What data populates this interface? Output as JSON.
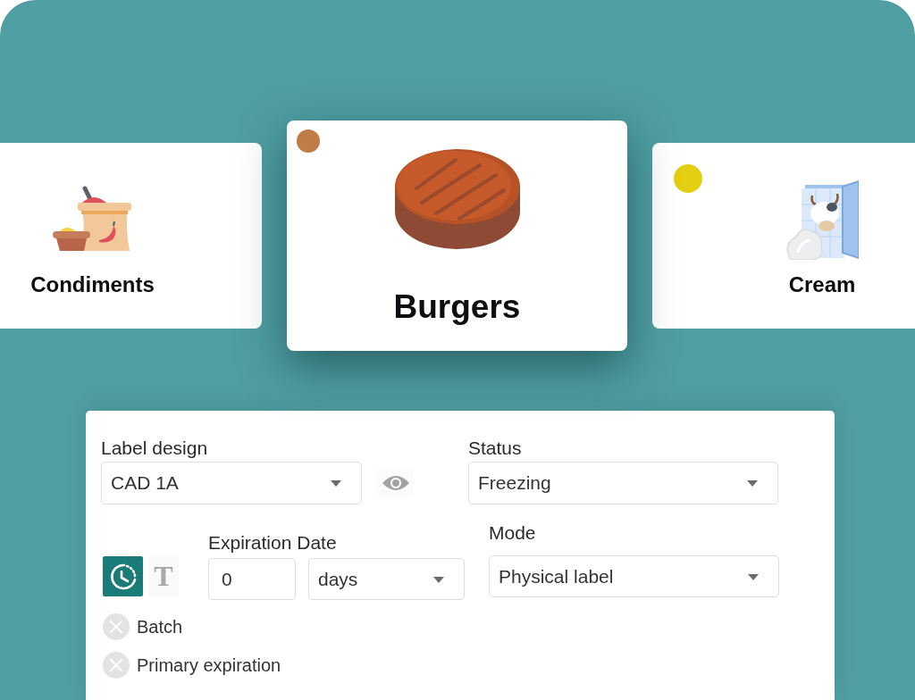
{
  "categories": [
    {
      "name": "Condiments",
      "kind": "spices",
      "selected": false
    },
    {
      "name": "Burgers",
      "kind": "patty",
      "selected": true,
      "color": "#c17c45"
    },
    {
      "name": "Cream",
      "kind": "cream",
      "selected": false,
      "color": "#e3cf10"
    }
  ],
  "form": {
    "label_design": {
      "label": "Label design",
      "value": "CAD 1A"
    },
    "status": {
      "label": "Status",
      "value": "Freezing"
    },
    "expiration_type": [
      {
        "kind": "timer",
        "selected": true
      },
      {
        "kind": "text",
        "icon": "T",
        "selected": false
      }
    ],
    "expiration_date": {
      "label": "Expiration Date",
      "amount": "0",
      "unit": "days"
    },
    "mode": {
      "label": "Mode",
      "value": "Physical label"
    },
    "options": [
      {
        "label": "Batch",
        "checked": false
      },
      {
        "label": "Primary expiration",
        "checked": false
      }
    ]
  }
}
